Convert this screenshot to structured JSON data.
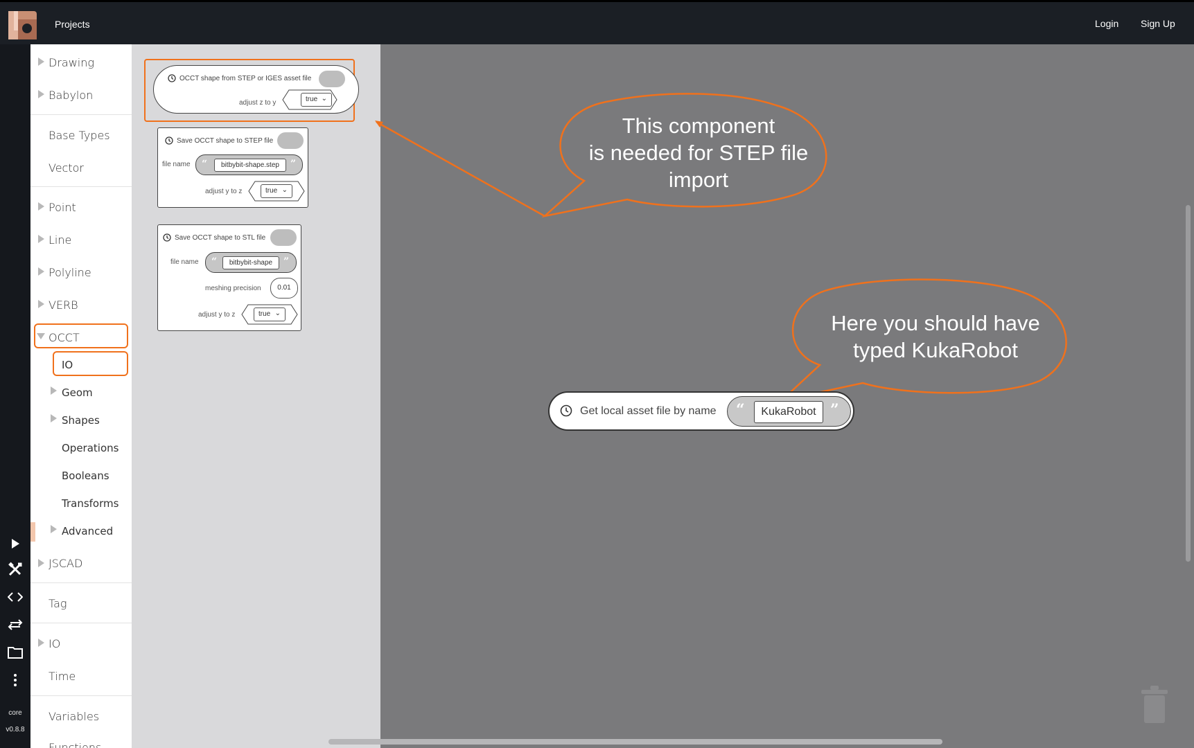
{
  "topbar": {
    "projects_label": "Projects",
    "login_label": "Login",
    "signup_label": "Sign Up"
  },
  "rail": {
    "buttons": [
      "play-icon",
      "tools-icon",
      "code-icon",
      "swap-icon",
      "folder-icon",
      "more-icon"
    ],
    "core_label": "core",
    "version_label": "v0.8.8"
  },
  "sidebar": {
    "items": [
      {
        "label": "Drawing"
      },
      {
        "label": "Babylon"
      },
      {
        "label": "Base Types"
      },
      {
        "label": "Vector"
      },
      {
        "label": "Point"
      },
      {
        "label": "Line"
      },
      {
        "label": "Polyline"
      },
      {
        "label": "VERB"
      },
      {
        "label": "OCCT"
      },
      {
        "label": "IO"
      },
      {
        "label": "Geom"
      },
      {
        "label": "Shapes"
      },
      {
        "label": "Operations"
      },
      {
        "label": "Booleans"
      },
      {
        "label": "Transforms"
      },
      {
        "label": "Advanced"
      },
      {
        "label": "JSCAD"
      },
      {
        "label": "Tag"
      },
      {
        "label": "IO"
      },
      {
        "label": "Time"
      },
      {
        "label": "Variables"
      },
      {
        "label": "Functions"
      }
    ]
  },
  "flyout": {
    "block1": {
      "title": "OCCT shape from STEP or IGES asset file",
      "param_label": "adjust z to y",
      "param_value": "true"
    },
    "block2": {
      "title": "Save OCCT shape to STEP file",
      "filename_label": "file name",
      "filename_value": "bitbybit-shape.step",
      "param_label": "adjust y to z",
      "param_value": "true"
    },
    "block3": {
      "title": "Save OCCT shape to STL file",
      "filename_label": "file name",
      "filename_value": "bitbybit-shape",
      "precision_label": "meshing precision",
      "precision_value": "0.01",
      "param_label": "adjust y to z",
      "param_value": "true"
    }
  },
  "workspace": {
    "block": {
      "label": "Get local asset file by name",
      "value": "KukaRobot"
    },
    "callout1": {
      "lines": [
        "This component",
        "is needed for STEP file",
        "import"
      ]
    },
    "callout2": {
      "lines": [
        "Here you should have",
        "typed KukaRobot"
      ]
    }
  },
  "colors": {
    "accent": "#f0711c",
    "topbar": "#1b1f25",
    "workspace": "#7a7a7c",
    "flyout": "#d9d9db"
  }
}
